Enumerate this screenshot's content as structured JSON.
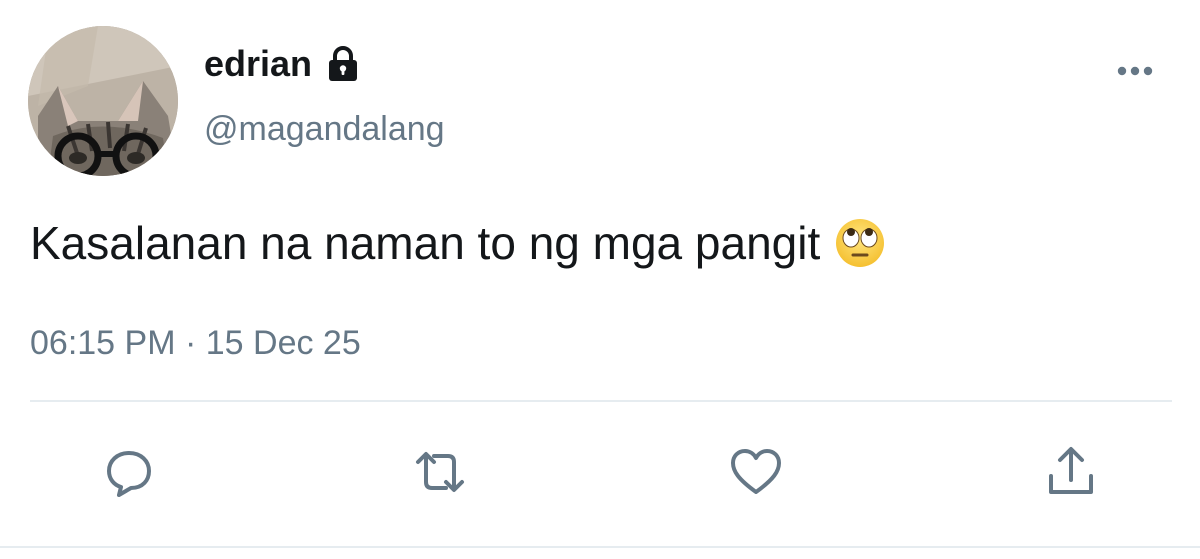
{
  "tweet": {
    "display_name": "edrian",
    "handle": "@magandalang",
    "text": "Kasalanan na naman to ng mga pangit",
    "emoji": "face-with-rolling-eyes",
    "timestamp": "06:15 PM · 15 Dec 25",
    "protected": true
  },
  "icons": {
    "lock": "lock-icon",
    "more": "more-icon",
    "reply": "reply-icon",
    "retweet": "retweet-icon",
    "like": "heart-icon",
    "share": "share-icon"
  },
  "colors": {
    "text_primary": "#14171a",
    "text_secondary": "#657786",
    "icon": "#657786",
    "divider": "#e6ecf0"
  }
}
